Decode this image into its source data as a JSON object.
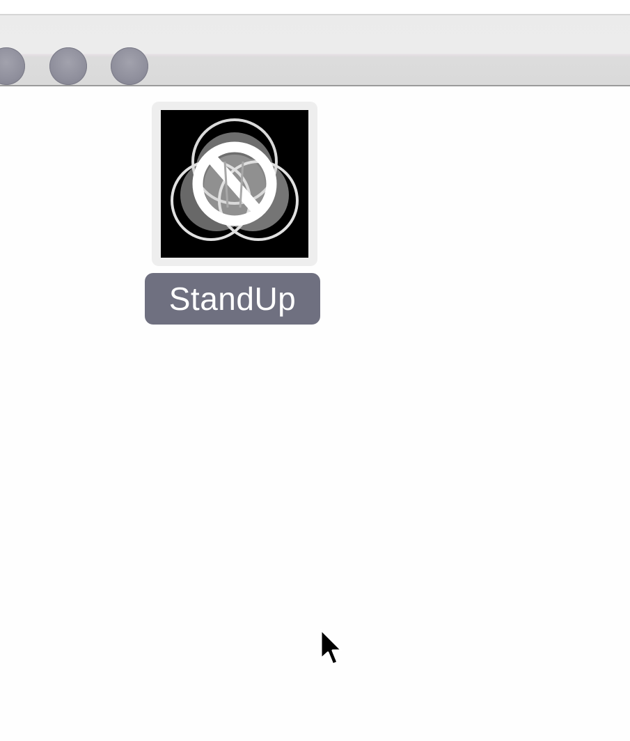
{
  "window": {
    "traffic_lights": [
      {
        "name": "close",
        "color": "#8f8f9c"
      },
      {
        "name": "minimize",
        "color": "#8f8f9c"
      },
      {
        "name": "zoom",
        "color": "#8f8f9c"
      }
    ]
  },
  "desktop_item": {
    "label": "StandUp",
    "icon": "standup-app-icon",
    "selected": true,
    "label_highlight_color": "#6f7080"
  },
  "cursor": {
    "icon": "arrow-pointer-icon"
  }
}
